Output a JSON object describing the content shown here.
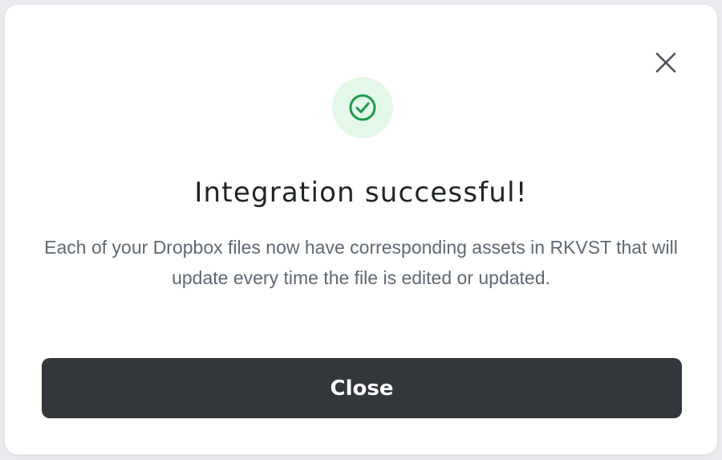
{
  "dialog": {
    "title": "Integration successful!",
    "message": "Each of your Dropbox files now have corresponding assets in RKVST that will update every time the file is edited or updated.",
    "close_button_label": "Close",
    "icons": {
      "dismiss": "close-icon",
      "status": "check-circle-icon"
    },
    "colors": {
      "success_accent": "#1e9a4c",
      "success_background": "#e3f8e9",
      "button_background": "#33363b",
      "button_text": "#ffffff"
    }
  }
}
